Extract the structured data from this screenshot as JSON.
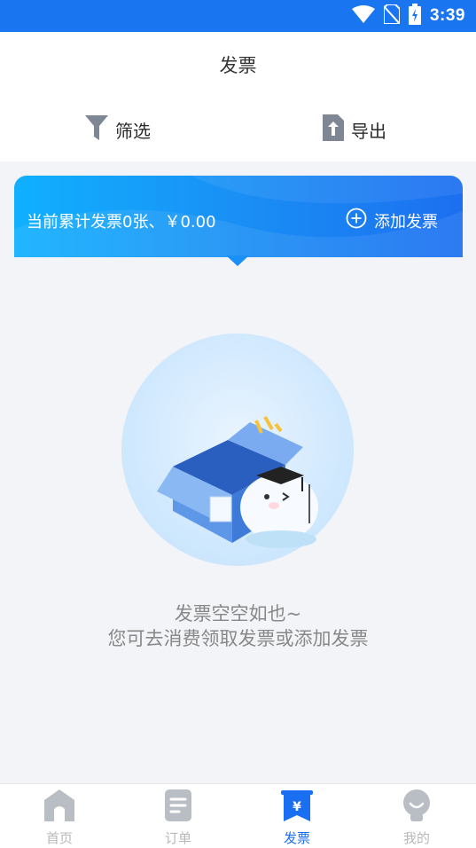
{
  "status_bar": {
    "time": "3:39",
    "icons": [
      "wifi-icon",
      "no-sim-icon",
      "battery-charging-icon"
    ]
  },
  "header": {
    "title": "发票"
  },
  "toolbar": {
    "filter_label": "筛选",
    "export_label": "导出"
  },
  "summary": {
    "text": "当前累计发票0张、￥0.00",
    "add_label": "添加发票"
  },
  "empty_state": {
    "line1": "发票空空如也~",
    "line2": "您可去消费领取发票或添加发票"
  },
  "tabbar": {
    "items": [
      {
        "label": "首页",
        "icon": "home-icon",
        "active": false
      },
      {
        "label": "订单",
        "icon": "order-icon",
        "active": false
      },
      {
        "label": "发票",
        "icon": "invoice-icon",
        "active": true
      },
      {
        "label": "我的",
        "icon": "profile-icon",
        "active": false
      }
    ]
  },
  "colors": {
    "primary": "#1a6ef2",
    "status_bar": "#1a76f0",
    "page_bg": "#f3f4f8",
    "tab_inactive": "#b8b8b8"
  }
}
